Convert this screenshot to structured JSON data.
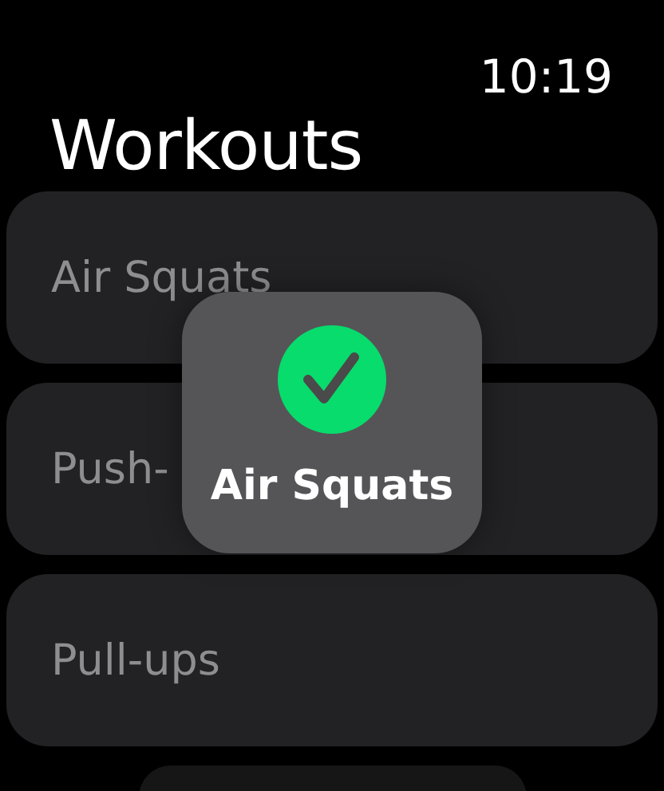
{
  "status_bar": {
    "time": "10:19"
  },
  "title": "Workouts",
  "workouts": [
    {
      "name": "Air Squats"
    },
    {
      "name": "Push-"
    },
    {
      "name": "Pull-ups"
    }
  ],
  "toast": {
    "kind": "success",
    "label": "Air Squats"
  }
}
